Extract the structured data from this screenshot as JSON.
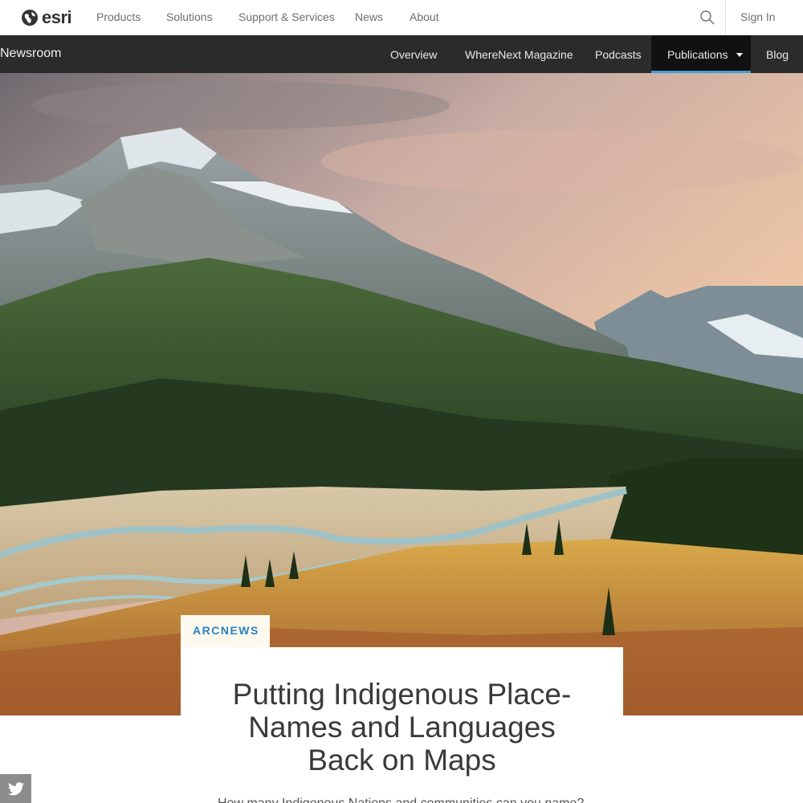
{
  "brand": {
    "name": "esri"
  },
  "topnav": {
    "items": [
      "Products",
      "Solutions",
      "Support & Services",
      "News",
      "About"
    ],
    "sign_in": "Sign In"
  },
  "subnav": {
    "title": "Newsroom",
    "items": [
      "Overview",
      "WhereNext Magazine",
      "Podcasts",
      "Publications",
      "Blog"
    ],
    "active": "Publications"
  },
  "hero": {
    "description_icon": "mountain-valley-photo"
  },
  "article": {
    "tag": "ARCNEWS",
    "title_lines": [
      "Putting Indigenous Place-",
      "Names and Languages",
      "Back on Maps"
    ],
    "lead": "How many Indigenous Nations and communities can you name?"
  },
  "share": {
    "twitter_icon": "twitter-icon"
  },
  "colors": {
    "subnav_bg": "#2b2b2b",
    "accent": "#3d9fd6",
    "tag_text": "#2d82c1"
  }
}
